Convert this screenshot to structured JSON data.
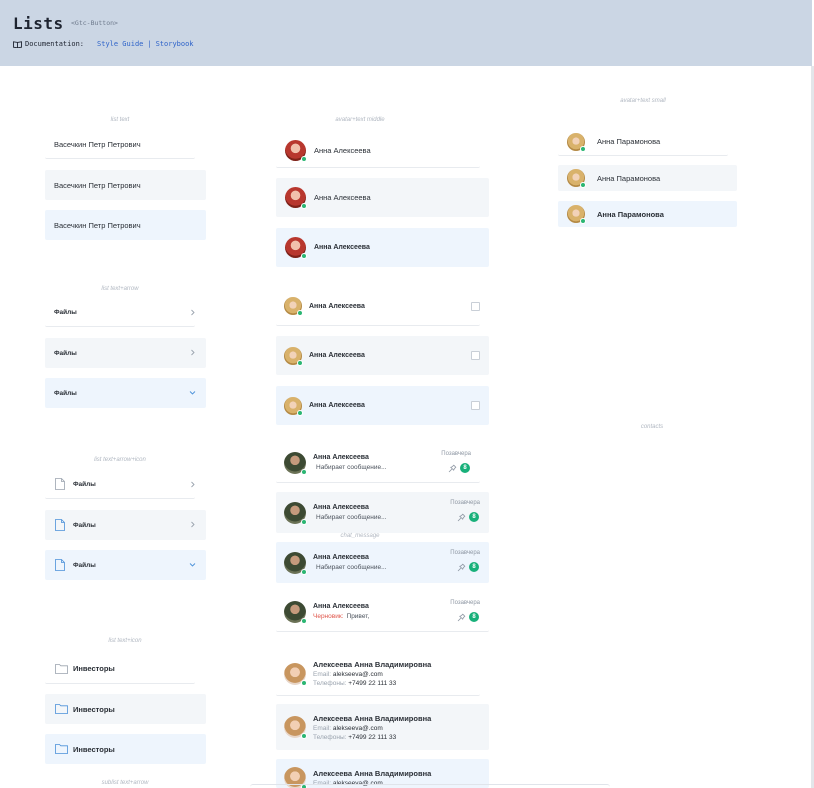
{
  "header": {
    "title": "Lists",
    "tag": "<Gtc-Button>",
    "docs_label": "Documentation:",
    "link_style_guide": "Style Guide",
    "separator": "|",
    "link_storybook": "Storybook"
  },
  "sections": {
    "list_text": "list text",
    "list_text_arrow": "list text+arrow",
    "list_text_arrow_icon": "list text+arrow+icon",
    "list_text_icon": "list text+icon",
    "sublist_text_arrow": "sublist text+arrow",
    "avatar_text_middle": "avatar+text middle",
    "chat_message": "chat_message",
    "avatar_text_small": "avatar+text small",
    "contacts": "contacts"
  },
  "list_text": [
    "Васечкин Петр Петрович",
    "Васечкин Петр Петрович",
    "Васечкин Петр Петрович"
  ],
  "list_text_arrow": [
    "Файлы",
    "Файлы",
    "Файлы"
  ],
  "list_text_arrow_icon": [
    "Файлы",
    "Файлы",
    "Файлы"
  ],
  "list_text_icon": [
    "Инвесторы",
    "Инвесторы",
    "Инвесторы"
  ],
  "avatar_middle": [
    "Анна Алексеева",
    "Анна Алексеева",
    "Анна Алексеева"
  ],
  "avatar_check": [
    "Анна Алексеева",
    "Анна Алексеева",
    "Анна Алексеева"
  ],
  "chats": [
    {
      "name": "Анна Алексеева",
      "time": "Позавчера",
      "message": "Набирает сообщение...",
      "draft": "",
      "count": "8"
    },
    {
      "name": "Анна Алексеева",
      "time": "Позавчера",
      "message": "Набирает сообщение...",
      "draft": "",
      "count": "8"
    },
    {
      "name": "Анна Алексеева",
      "time": "Позавчера",
      "message": "Набирает сообщение...",
      "draft": "",
      "count": "8"
    },
    {
      "name": "Анна Алексеева",
      "time": "Позавчера",
      "message": "Привет,",
      "draft": "Черновик:",
      "count": "8"
    }
  ],
  "contacts": [
    {
      "name": "Алексеева Анна Владимировна",
      "email_label": "Email:",
      "email": "alekseeva@.com",
      "phone_label": "Телефоны:",
      "phone": "+7499 22 111 33"
    },
    {
      "name": "Алексеева Анна Владимировна",
      "email_label": "Email:",
      "email": "alekseeva@.com",
      "phone_label": "Телефоны:",
      "phone": "+7499 22 111 33"
    },
    {
      "name": "Алексеева Анна Владимировна",
      "email_label": "Email:",
      "email": "alekseeva@.com",
      "phone_label": "",
      "phone": ""
    }
  ],
  "avatar_small": [
    "Анна Парамонова",
    "Анна Парамонова",
    "Анна Парамонова"
  ],
  "colors": {
    "header_bg": "#cbd6e4",
    "link": "#2e63c9",
    "hover_bg": "#f3f6f9",
    "active_bg": "#eef5fd",
    "online": "#2bb673",
    "badge": "#18b07a",
    "draft": "#e0564b",
    "active_icon": "#4a90d9"
  }
}
